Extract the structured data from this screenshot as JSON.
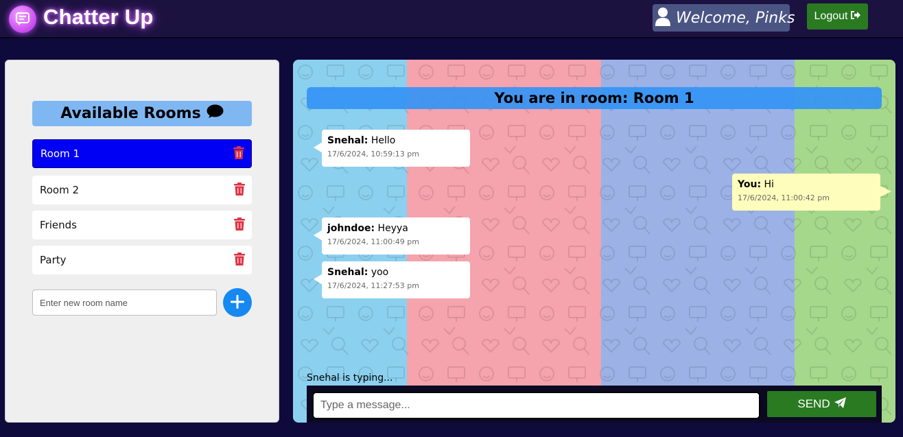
{
  "header": {
    "brand": "Chatter Up",
    "welcome": "Welcome, Pinks",
    "logout_label": "Logout"
  },
  "sidebar": {
    "title": "Available Rooms",
    "rooms": [
      {
        "label": "Room 1",
        "active": true
      },
      {
        "label": "Room 2",
        "active": false
      },
      {
        "label": "Friends",
        "active": false
      },
      {
        "label": "Party",
        "active": false
      }
    ],
    "new_room_placeholder": "Enter new room name"
  },
  "chat": {
    "banner": "You are in room: Room 1",
    "messages": [
      {
        "author": "Snehal:",
        "text": "Hello",
        "time": "17/6/2024, 10:59:13 pm",
        "mine": false
      },
      {
        "author": "You:",
        "text": "Hi",
        "time": "17/6/2024, 11:00:42 pm",
        "mine": true
      },
      {
        "author": "johndoe:",
        "text": "Heyya",
        "time": "17/6/2024, 11:00:49 pm",
        "mine": false
      },
      {
        "author": "Snehal:",
        "text": "yoo",
        "time": "17/6/2024, 11:27:53 pm",
        "mine": false
      }
    ],
    "typing": "Snehal is typing...",
    "input_placeholder": "Type a message...",
    "send_label": "SEND"
  },
  "colors": {
    "accent_blue": "#0000f5",
    "send_green": "#2a7a21",
    "delete_red": "#dc3545",
    "stripes": [
      "#8cd0ef",
      "#f5a3ad",
      "#9cb2e6",
      "#a6d88c"
    ]
  },
  "icons": {
    "brand": "chat-logo-icon",
    "user": "user-icon",
    "logout": "sign-out-icon",
    "rooms_title": "comment-icon",
    "delete": "trash-icon",
    "add": "plus-icon",
    "send": "paper-plane-icon"
  }
}
